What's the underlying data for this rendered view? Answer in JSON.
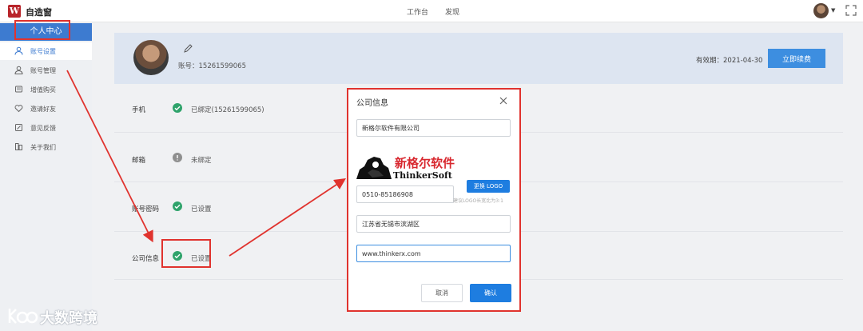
{
  "topbar": {
    "logo_letter": "W",
    "app_name": "自造窗",
    "nav": [
      "工作台",
      "发现"
    ]
  },
  "sidebar": {
    "header": "个人中心",
    "items": [
      {
        "label": "账号设置",
        "icon": "user-icon",
        "active": true
      },
      {
        "label": "账号管理",
        "icon": "users-icon",
        "active": false
      },
      {
        "label": "增值购买",
        "icon": "cart-icon",
        "active": false
      },
      {
        "label": "邀请好友",
        "icon": "heart-icon",
        "active": false
      },
      {
        "label": "意见反馈",
        "icon": "feedback-icon",
        "active": false
      },
      {
        "label": "关于我们",
        "icon": "info-icon",
        "active": false
      }
    ]
  },
  "profile": {
    "account": "账号：15261599065",
    "expiry": "有效期：2021-04-30",
    "renew_label": "立即续费"
  },
  "rows": [
    {
      "label": "手机",
      "status": "ok",
      "value": "已绑定(15261599065)"
    },
    {
      "label": "邮箱",
      "status": "no",
      "value": "未绑定"
    },
    {
      "label": "账号密码",
      "status": "ok",
      "value": "已设置"
    },
    {
      "label": "公司信息",
      "status": "ok",
      "value": "已设置"
    }
  ],
  "modal": {
    "title": "公司信息",
    "company_name": "新格尔软件有限公司",
    "logo_cn": "新格尔软件",
    "logo_en": "ThinkerSoft",
    "change_logo_label": "更换 LOGO",
    "logo_hint": "建议LOGO长宽比为3:1",
    "phone": "0510-85186908",
    "address": "江苏省无锡市滨湖区",
    "website": "www.thinkerx.com",
    "cancel_label": "取消",
    "confirm_label": "确认"
  },
  "watermark": {
    "text": "大数跨境"
  },
  "colors": {
    "accent": "#3d8ee0",
    "annotation": "#e0332e",
    "success": "#2fa36b"
  }
}
